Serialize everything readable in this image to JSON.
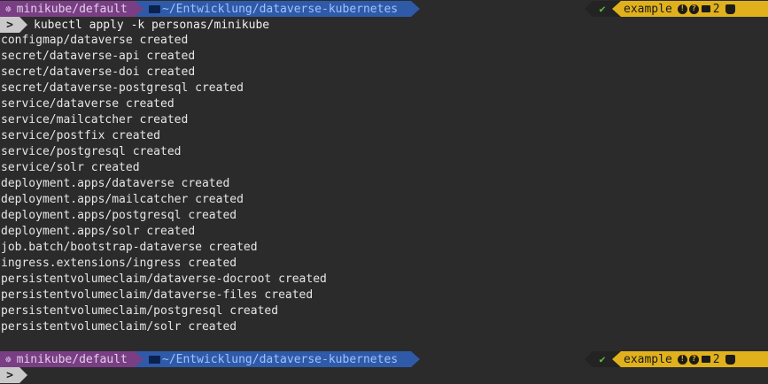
{
  "prompt": {
    "k8s_glyph": "☸",
    "context": "minikube/default",
    "path": "~/Entwicklung/dataverse-kubernetes",
    "status_check": "✔",
    "git_branch_glyph": "",
    "git_branch": "example",
    "git_staged": "!",
    "git_unknown": "?",
    "git_count": "2",
    "chevron": ">"
  },
  "command": "kubectl apply -k personas/minikube",
  "output_lines": [
    "configmap/dataverse created",
    "secret/dataverse-api created",
    "secret/dataverse-doi created",
    "secret/dataverse-postgresql created",
    "service/dataverse created",
    "service/mailcatcher created",
    "service/postfix created",
    "service/postgresql created",
    "service/solr created",
    "deployment.apps/dataverse created",
    "deployment.apps/mailcatcher created",
    "deployment.apps/postgresql created",
    "deployment.apps/solr created",
    "job.batch/bootstrap-dataverse created",
    "ingress.extensions/ingress created",
    "persistentvolumeclaim/dataverse-docroot created",
    "persistentvolumeclaim/dataverse-files created",
    "persistentvolumeclaim/postgresql created",
    "persistentvolumeclaim/solr created"
  ],
  "icons": {
    "kubernetes": "kubernetes-icon",
    "folder": "folder-icon",
    "check": "check-icon",
    "branch": "git-branch-icon",
    "stash": "inbox-icon",
    "github": "github-cat-icon"
  },
  "colors": {
    "background": "#2b2b2b",
    "k8s_segment": "#7a3e85",
    "dir_segment": "#2f5aa8",
    "git_segment": "#e0b11c",
    "status_ok": "#5fbf3a"
  }
}
